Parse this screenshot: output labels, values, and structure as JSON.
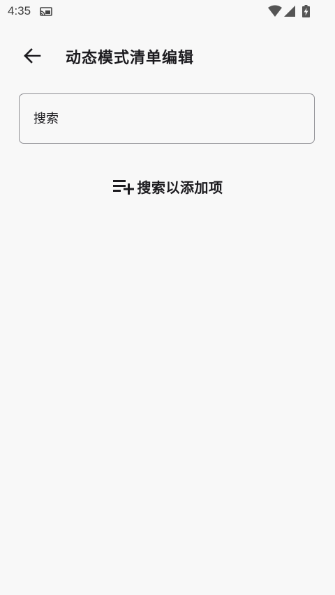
{
  "status_bar": {
    "time": "4:35",
    "icons": [
      "cast-notification-icon",
      "wifi-icon",
      "signal-icon",
      "battery-charging-icon"
    ]
  },
  "app_bar": {
    "title": "动态模式清单编辑",
    "back_icon": "arrow-back-icon"
  },
  "search": {
    "placeholder": "搜索",
    "value": ""
  },
  "hint": {
    "icon": "playlist-add-icon",
    "text": "搜索以添加项"
  },
  "colors": {
    "background": "#f8f8f8",
    "text": "#1c1b1f",
    "field_border": "#8e8e93"
  }
}
